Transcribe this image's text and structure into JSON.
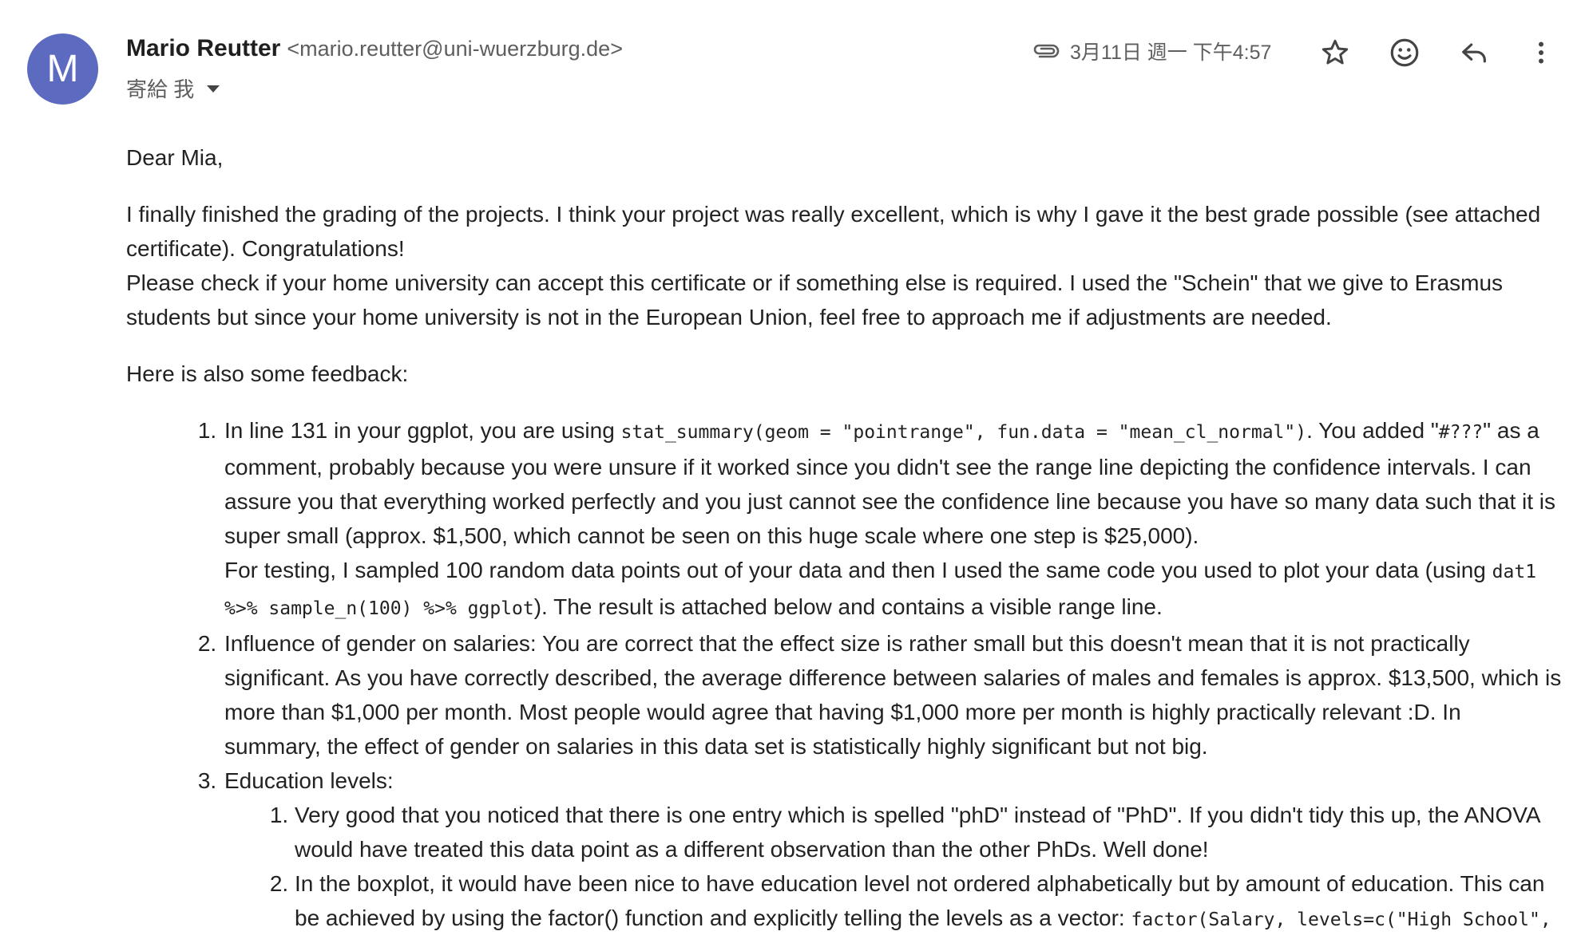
{
  "sender": {
    "avatar_letter": "M",
    "name": "Mario Reutter",
    "email": "<mario.reutter@uni-wuerzburg.de>",
    "recipient": "寄給 我"
  },
  "header": {
    "date": "3月11日 週一 下午4:57",
    "icons": [
      "attachment-icon",
      "star-icon",
      "emoji-icon",
      "reply-icon",
      "more-vert-icon"
    ],
    "avatar_color": "#5c6bc0"
  },
  "body": {
    "greeting": "Dear Mia,",
    "para1_line1": "I finally finished the grading of the projects. I think your project was really excellent, which is why I gave it the best grade possible (see attached certificate). Congratulations!",
    "para1_line2": "Please check if your home university can accept this certificate or if something else is required. I used the \"Schein\" that we give to Erasmus students but since your home university is not in the European Union, feel free to approach me if adjustments are needed.",
    "feedback_intro": "Here is also some feedback:",
    "item1": {
      "t1": "In line 131 in your ggplot, you are using ",
      "code1": "stat_summary(geom = \"pointrange\", fun.data = \"mean_cl_normal\")",
      "t2": ". You added \"",
      "code2": "#???",
      "t3": "\" as a comment, probably because you were unsure if it worked since you didn't see the range line depicting the confidence intervals. I can assure you that everything worked perfectly and you just cannot see the confidence line because you have so many data such that it is super small (approx. $1,500, which cannot be seen on this huge scale where one step is $25,000).",
      "t4": "For testing, I sampled 100 random data points out of your data and then I used the same code you used to plot your data (using ",
      "code3": "dat1 %>% sample_n(100) %>% ggplot",
      "t5": "). The result is attached below and contains a visible range line."
    },
    "item2": "Influence of gender on salaries: You are correct that the effect size is rather small but this doesn't mean that it is not practically significant. As you have correctly described, the average difference between salaries of males and females is approx. $13,500, which is more than $1,000 per month. Most people would agree that having $1,000 more per month is highly practically relevant :D. In summary, the effect of gender on salaries in this data set is statistically highly significant but not big.",
    "item3": {
      "label": "Education levels:",
      "sub1": "Very good that you noticed that there is one entry which is spelled \"phD\" instead of \"PhD\". If you didn't tidy this up, the ANOVA would have treated this data point as a different observation than the other PhDs. Well done!",
      "sub2_text": "In the boxplot, it would have been nice to have education level not ordered alphabetically but by amount of education. This can be achieved by using the factor() function and explicitly telling the levels as a vector: ",
      "sub2_code": "factor(Salary, levels=c(\"High School\", \"Bachelor's\", \"Master's\", \"PhD\"))"
    }
  }
}
